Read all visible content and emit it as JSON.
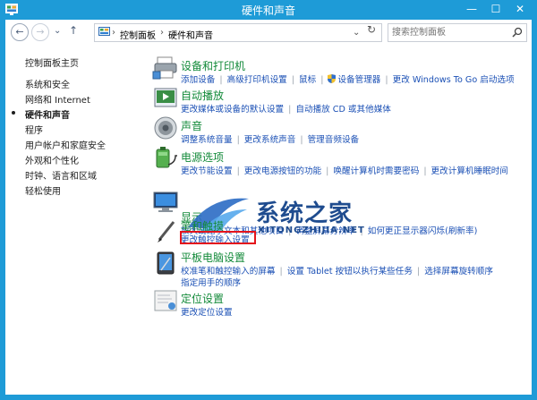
{
  "window": {
    "title": "硬件和声音",
    "minimize": "—",
    "maximize": "☐",
    "close": "✕"
  },
  "nav": {
    "back": "←",
    "forward": "→",
    "recent": "⌄",
    "up": "↑",
    "breadcrumb": [
      "控制面板",
      "硬件和声音"
    ],
    "sep": "›",
    "refresh": "↻",
    "search_placeholder": "搜索控制面板",
    "accent": "#1e9bd7"
  },
  "sidebar": {
    "items": [
      {
        "label": "控制面板主页"
      },
      {
        "label": "系统和安全"
      },
      {
        "label": "网络和 Internet"
      },
      {
        "label": "硬件和声音",
        "current": true
      },
      {
        "label": "程序"
      },
      {
        "label": "用户帐户和家庭安全"
      },
      {
        "label": "外观和个性化"
      },
      {
        "label": "时钟、语言和区域"
      },
      {
        "label": "轻松使用"
      }
    ]
  },
  "categories": [
    {
      "title": "设备和打印机",
      "icon": "printer-icon",
      "links": [
        "添加设备",
        "高级打印机设置",
        "鼠标",
        "设备管理器",
        "更改 Windows To Go 启动选项"
      ]
    },
    {
      "title": "自动播放",
      "icon": "autoplay-icon",
      "links": [
        "更改媒体或设备的默认设置",
        "自动播放 CD 或其他媒体"
      ]
    },
    {
      "title": "声音",
      "icon": "speaker-icon",
      "links": [
        "调整系统音量",
        "更改系统声音",
        "管理音频设备"
      ]
    },
    {
      "title": "电源选项",
      "icon": "battery-icon",
      "links": [
        "更改节能设置",
        "更改电源按钮的功能",
        "唤醒计算机时需要密码",
        "更改计算机睡眠时间"
      ]
    },
    {
      "title": "显示",
      "icon": "display-icon",
      "links": [
        "放大或缩小文本和其他项目",
        "调整屏幕分辨率",
        "如何更正显示器闪烁(刷新率)"
      ]
    },
    {
      "title": "笔和触摸",
      "icon": "pen-icon",
      "links": [
        "更改触控输入设置"
      ]
    },
    {
      "title": "平板电脑设置",
      "icon": "tablet-icon",
      "links": [
        "校准笔和触控输入的屏幕",
        "设置 Tablet 按钮以执行某些任务",
        "选择屏幕旋转顺序"
      ],
      "links2": [
        "指定用手的顺序"
      ]
    },
    {
      "title": "定位设置",
      "icon": "location-icon",
      "links": [
        "更改定位设置"
      ]
    }
  ],
  "watermark": {
    "text": "系统之家",
    "sub": "XITONGZHIJIA.NET"
  },
  "highlight_color": "#e4141c"
}
